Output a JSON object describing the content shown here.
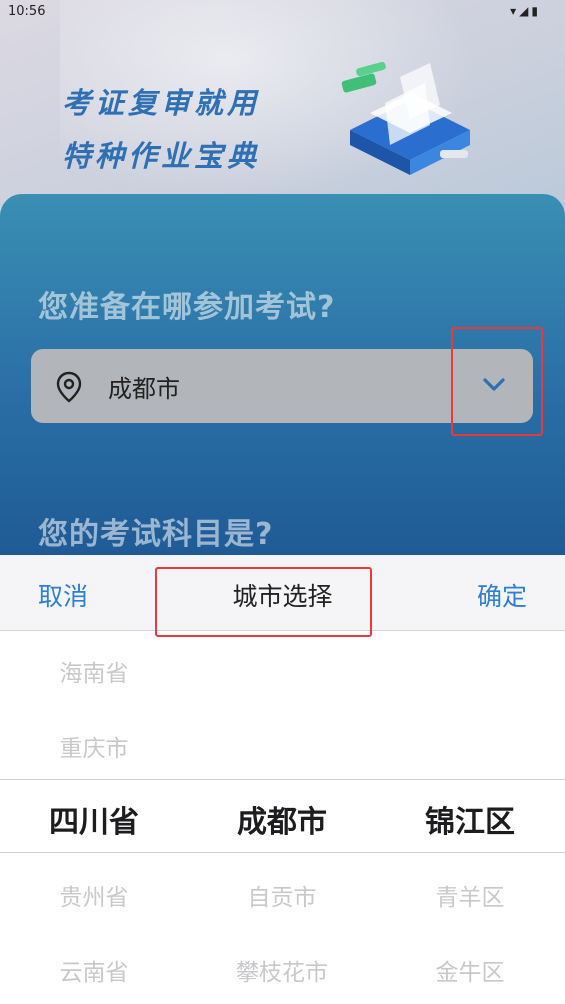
{
  "status_bar": {
    "time": "10:56"
  },
  "banner": {
    "line1": "考证复审就用",
    "line2": "特种作业宝典"
  },
  "form": {
    "question1": "您准备在哪参加考试?",
    "city_value": "成都市",
    "question2": "您的考试科目是?"
  },
  "picker": {
    "cancel_label": "取消",
    "title": "城市选择",
    "confirm_label": "确定",
    "provinces": [
      "海南省",
      "重庆市",
      "四川省",
      "贵州省",
      "云南省"
    ],
    "cities": [
      "成都市",
      "自贡市",
      "攀枝花市"
    ],
    "districts": [
      "锦江区",
      "青羊区",
      "金牛区"
    ]
  },
  "colors": {
    "accent_blue": "#2f7fd4",
    "banner_text": "#2f6fb3",
    "card_gradient_top": "#3a8fb4",
    "card_gradient_bottom": "#1f5a95",
    "highlight_red": "#e53b3b"
  },
  "icons": {
    "location": "location-pin-icon",
    "dropdown": "chevron-down-icon"
  }
}
